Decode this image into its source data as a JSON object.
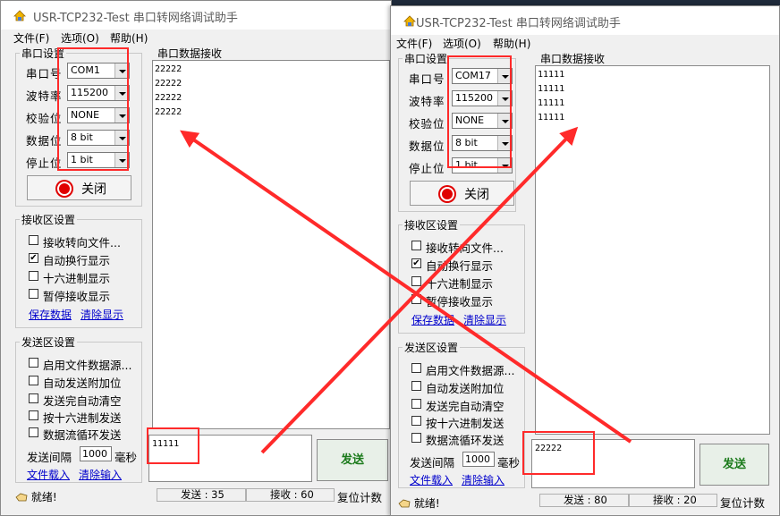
{
  "windows": [
    {
      "title": "USR-TCP232-Test 串口转网络调试助手",
      "menu": [
        "文件(F)",
        "选项(O)",
        "帮助(H)"
      ],
      "serial_settings": {
        "group_label": "串口设置",
        "port_label": "串口号",
        "port_value": "COM1",
        "baud_label": "波特率",
        "baud_value": "115200",
        "parity_label": "校验位",
        "parity_value": "NONE",
        "databits_label": "数据位",
        "databits_value": "8 bit",
        "stopbits_label": "停止位",
        "stopbits_value": "1 bit",
        "toggle_label": "关闭"
      },
      "receive_settings": {
        "group_label": "接收区设置",
        "options": [
          {
            "label": "接收转向文件...",
            "checked": false
          },
          {
            "label": "自动换行显示",
            "checked": true
          },
          {
            "label": "十六进制显示",
            "checked": false
          },
          {
            "label": "暂停接收显示",
            "checked": false
          }
        ],
        "save_link": "保存数据",
        "clear_link": "清除显示"
      },
      "send_settings": {
        "group_label": "发送区设置",
        "options": [
          {
            "label": "启用文件数据源...",
            "checked": false
          },
          {
            "label": "自动发送附加位",
            "checked": false
          },
          {
            "label": "发送完自动清空",
            "checked": false
          },
          {
            "label": "按十六进制发送",
            "checked": false
          },
          {
            "label": "数据流循环发送",
            "checked": false
          }
        ],
        "interval_label": "发送间隔",
        "interval_value": "1000",
        "interval_unit": "毫秒",
        "load_link": "文件载入",
        "clear_link": "清除输入"
      },
      "receive_area": {
        "label": "串口数据接收",
        "lines": [
          "22222",
          "22222",
          "22222",
          "22222"
        ]
      },
      "send_input": "11111",
      "send_button": "发送",
      "status": {
        "ready": "就绪!",
        "sent": "发送 : 35",
        "received": "接收 : 60",
        "reset": "复位计数"
      }
    },
    {
      "title": "USR-TCP232-Test 串口转网络调试助手",
      "menu": [
        "文件(F)",
        "选项(O)",
        "帮助(H)"
      ],
      "serial_settings": {
        "group_label": "串口设置",
        "port_label": "串口号",
        "port_value": "COM17",
        "baud_label": "波特率",
        "baud_value": "115200",
        "parity_label": "校验位",
        "parity_value": "NONE",
        "databits_label": "数据位",
        "databits_value": "8 bit",
        "stopbits_label": "停止位",
        "stopbits_value": "1 bit",
        "toggle_label": "关闭"
      },
      "receive_settings": {
        "group_label": "接收区设置",
        "options": [
          {
            "label": "接收转向文件...",
            "checked": false
          },
          {
            "label": "自动换行显示",
            "checked": true
          },
          {
            "label": "十六进制显示",
            "checked": false
          },
          {
            "label": "暂停接收显示",
            "checked": false
          }
        ],
        "save_link": "保存数据",
        "clear_link": "清除显示"
      },
      "send_settings": {
        "group_label": "发送区设置",
        "options": [
          {
            "label": "启用文件数据源...",
            "checked": false
          },
          {
            "label": "自动发送附加位",
            "checked": false
          },
          {
            "label": "发送完自动清空",
            "checked": false
          },
          {
            "label": "按十六进制发送",
            "checked": false
          },
          {
            "label": "数据流循环发送",
            "checked": false
          }
        ],
        "interval_label": "发送间隔",
        "interval_value": "1000",
        "interval_unit": "毫秒",
        "load_link": "文件载入",
        "clear_link": "清除输入"
      },
      "receive_area": {
        "label": "串口数据接收",
        "lines": [
          "11111",
          "11111",
          "11111",
          "11111"
        ]
      },
      "send_input": "22222",
      "send_button": "发送",
      "status": {
        "ready": "就绪!",
        "sent": "发送 : 80",
        "received": "接收 : 20",
        "reset": "复位计数"
      }
    }
  ],
  "colors": {
    "annotation": "#ff2a2a",
    "send_button_text": "#1a7a1a",
    "link": "#0000cc"
  }
}
